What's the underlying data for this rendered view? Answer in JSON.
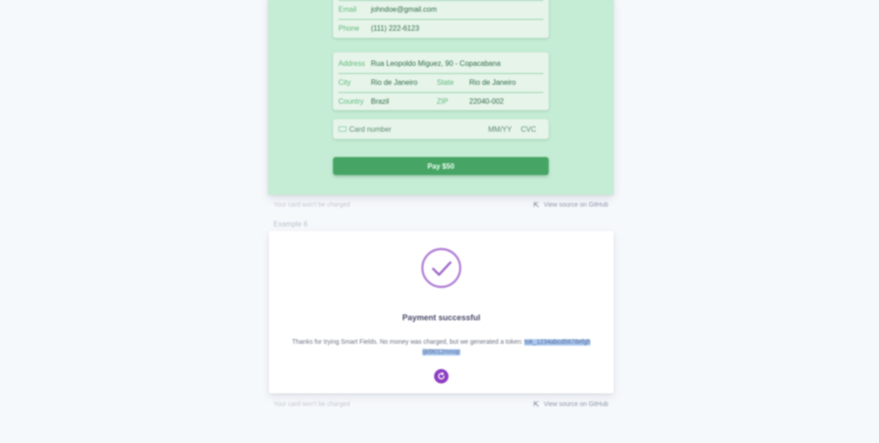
{
  "example5": {
    "contact": {
      "email_label": "Email",
      "email_value": "johndoe@gmail.com",
      "phone_label": "Phone",
      "phone_value": "(111) 222-6123"
    },
    "address": {
      "address_label": "Address",
      "address_value": "Rua Leopoldo Miguez, 90 - Copacabana",
      "city_label": "City",
      "city_value": "Rio de Janeiro",
      "state_label": "State",
      "state_value": "Rio de Janeiro",
      "country_label": "Country",
      "country_value": "Brazil",
      "zip_label": "ZIP",
      "zip_value": "22040-002"
    },
    "card": {
      "card_number_placeholder": "Card number",
      "expiry_placeholder": "MM/YY",
      "cvc_placeholder": "CVC"
    },
    "pay_button_label": "Pay $50",
    "accent_color": "#46a565"
  },
  "footer": {
    "note": "Your card won't be charged",
    "source_link": "View source on GitHub"
  },
  "example6": {
    "label": "Example 6",
    "success_title": "Payment successful",
    "message_plain": "Thanks for trying Smart Fields. No money was charged, but we generated a token: ",
    "message_highlight": "tok_1234abcd5678efgh ijkl9012mnop",
    "accent_color": "#8d3ec2",
    "icons": [
      "check-circle-icon",
      "reset-icon"
    ]
  }
}
